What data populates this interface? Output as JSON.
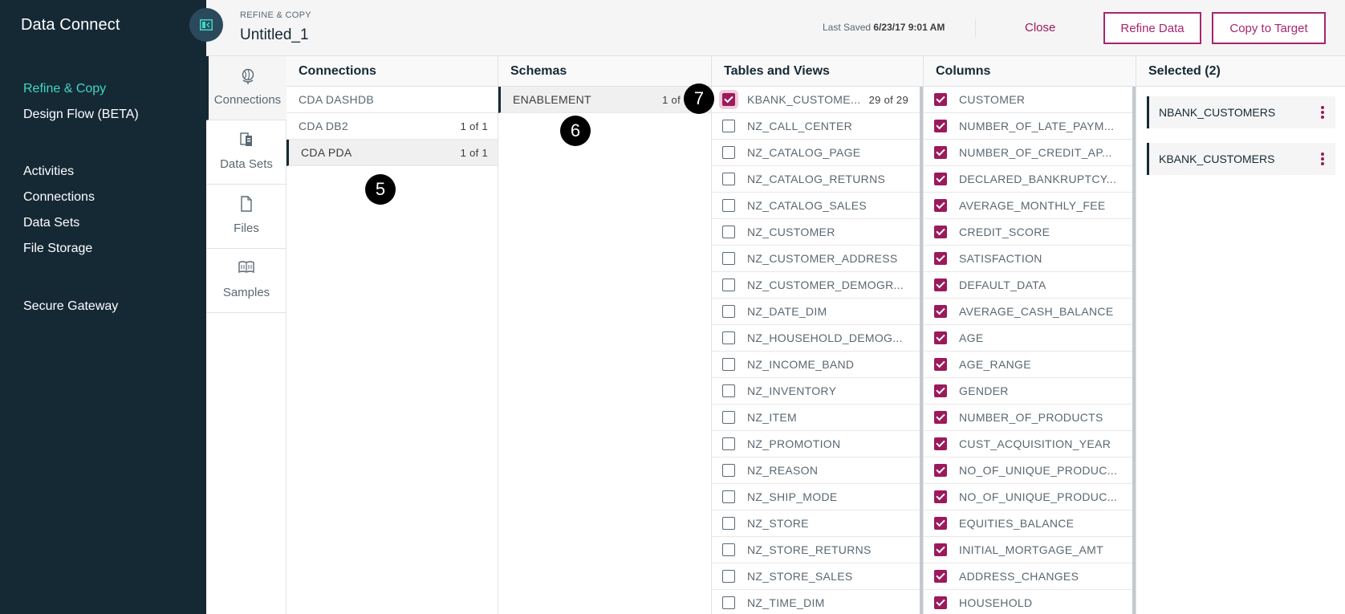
{
  "nav": {
    "app_title": "Data Connect",
    "primary": [
      "Refine & Copy",
      "Design Flow (BETA)"
    ],
    "secondary": [
      "Activities",
      "Connections",
      "Data Sets",
      "File Storage"
    ],
    "tertiary": [
      "Secure Gateway"
    ],
    "active_color": "#41d6c3"
  },
  "header": {
    "eyebrow": "REFINE & COPY",
    "title": "Untitled_1",
    "last_saved_label": "Last Saved",
    "last_saved_value": "6/23/17 9:01 AM",
    "close_label": "Close",
    "refine_label": "Refine Data",
    "copy_label": "Copy to Target",
    "accent": "#a6266e"
  },
  "rail": {
    "tabs": [
      {
        "label": "Connections",
        "icon": "globe-icon",
        "selected": true
      },
      {
        "label": "Data Sets",
        "icon": "dataset-icon",
        "selected": false
      },
      {
        "label": "Files",
        "icon": "file-icon",
        "selected": false
      },
      {
        "label": "Samples",
        "icon": "book-icon",
        "selected": false
      }
    ]
  },
  "connections": {
    "title": "Connections",
    "items": [
      {
        "name": "CDA DASHDB",
        "count": ""
      },
      {
        "name": "CDA DB2",
        "count": "1 of 1"
      },
      {
        "name": "CDA PDA",
        "count": "1 of 1",
        "selected": true
      }
    ]
  },
  "schemas": {
    "title": "Schemas",
    "items": [
      {
        "name": "ENABLEMENT",
        "count": "1 of",
        "selected": true
      }
    ]
  },
  "tables": {
    "title": "Tables and Views",
    "items": [
      {
        "name": "KBANK_CUSTOMERS",
        "display": "KBANK_CUSTOME...",
        "count": "29 of 29",
        "checked": true
      },
      {
        "name": "NZ_CALL_CENTER",
        "checked": false
      },
      {
        "name": "NZ_CATALOG_PAGE",
        "checked": false
      },
      {
        "name": "NZ_CATALOG_RETURNS",
        "checked": false
      },
      {
        "name": "NZ_CATALOG_SALES",
        "checked": false
      },
      {
        "name": "NZ_CUSTOMER",
        "checked": false
      },
      {
        "name": "NZ_CUSTOMER_ADDRESS",
        "checked": false
      },
      {
        "name": "NZ_CUSTOMER_DEMOGR...",
        "checked": false
      },
      {
        "name": "NZ_DATE_DIM",
        "checked": false
      },
      {
        "name": "NZ_HOUSEHOLD_DEMOG...",
        "checked": false
      },
      {
        "name": "NZ_INCOME_BAND",
        "checked": false
      },
      {
        "name": "NZ_INVENTORY",
        "checked": false
      },
      {
        "name": "NZ_ITEM",
        "checked": false
      },
      {
        "name": "NZ_PROMOTION",
        "checked": false
      },
      {
        "name": "NZ_REASON",
        "checked": false
      },
      {
        "name": "NZ_SHIP_MODE",
        "checked": false
      },
      {
        "name": "NZ_STORE",
        "checked": false
      },
      {
        "name": "NZ_STORE_RETURNS",
        "checked": false
      },
      {
        "name": "NZ_STORE_SALES",
        "checked": false
      },
      {
        "name": "NZ_TIME_DIM",
        "checked": false
      }
    ]
  },
  "columns": {
    "title": "Columns",
    "items": [
      "CUSTOMER",
      "NUMBER_OF_LATE_PAYM...",
      "NUMBER_OF_CREDIT_AP...",
      "DECLARED_BANKRUPTCY...",
      "AVERAGE_MONTHLY_FEE",
      "CREDIT_SCORE",
      "SATISFACTION",
      "DEFAULT_DATA",
      "AVERAGE_CASH_BALANCE",
      "AGE",
      "AGE_RANGE",
      "GENDER",
      "NUMBER_OF_PRODUCTS",
      "CUST_ACQUISITION_YEAR",
      "NO_OF_UNIQUE_PRODUC...",
      "NO_OF_UNIQUE_PRODUC...",
      "EQUITIES_BALANCE",
      "INITIAL_MORTGAGE_AMT",
      "ADDRESS_CHANGES",
      "HOUSEHOLD"
    ]
  },
  "selected": {
    "title": "Selected (2)",
    "items": [
      "NBANK_CUSTOMERS",
      "KBANK_CUSTOMERS"
    ]
  },
  "callouts": [
    "5",
    "6",
    "7"
  ]
}
